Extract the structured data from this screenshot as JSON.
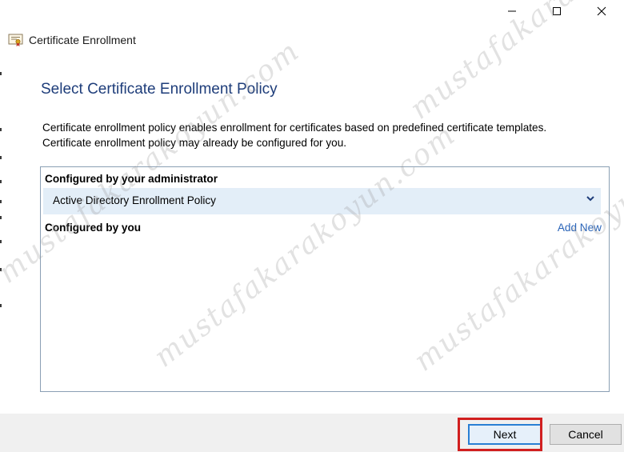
{
  "window": {
    "title": "Certificate Enrollment",
    "controls": [
      "minimize-icon",
      "maximize-icon",
      "close-icon"
    ]
  },
  "page": {
    "heading": "Select Certificate Enrollment Policy",
    "description_line1": "Certificate enrollment policy enables enrollment for certificates based on predefined certificate templates.",
    "description_line2": "Certificate enrollment policy may already be configured for you."
  },
  "policies": {
    "admin_group_label": "Configured by your administrator",
    "admin_items": [
      {
        "name": "Active Directory Enrollment Policy",
        "icon": "chevron-down-icon"
      }
    ],
    "user_group_label": "Configured by you",
    "add_new_label": "Add New"
  },
  "footer": {
    "next_label": "Next",
    "cancel_label": "Cancel"
  },
  "watermark": {
    "text": "mustafakarakoyun.com"
  },
  "colors": {
    "heading": "#1e3d7a",
    "link": "#2a64b8",
    "selected_row": "#e3eef8",
    "highlight_box": "#d11f1f"
  }
}
